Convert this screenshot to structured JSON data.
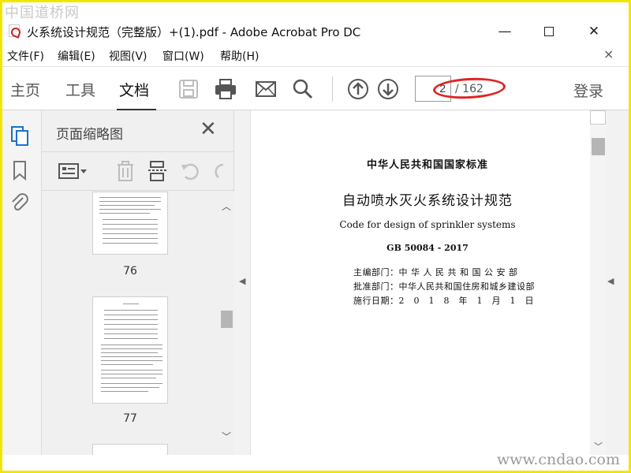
{
  "watermarks": {
    "top": "中国道桥网",
    "bottom": "www.cndao.com"
  },
  "window": {
    "title": "火系统设计规范（完整版）+(1).pdf - Adobe Acrobat Pro DC",
    "minimize": "—",
    "close": "✕"
  },
  "menu": {
    "items": [
      "文件(F)",
      "编辑(E)",
      "视图(V)",
      "窗口(W)",
      "帮助(H)"
    ],
    "close": "×"
  },
  "toolbar": {
    "tabs": [
      "主页",
      "工具",
      "文档"
    ],
    "active_tab": "文档",
    "tools": [
      "save-icon",
      "print-icon",
      "mail-icon",
      "search-icon",
      "page-up-icon",
      "page-down-icon"
    ],
    "page_current": "2",
    "page_total": "/ 162",
    "login": "登录",
    "highlight_color": "#e02424"
  },
  "thumbnail_pane": {
    "title": "页面缩略图",
    "close": "✕",
    "tools": [
      "thumbnail-options-icon",
      "delete-icon",
      "extract-icon",
      "undo-icon",
      "redo-icon"
    ],
    "thumbnails": [
      {
        "label": "76"
      },
      {
        "label": "77"
      }
    ]
  },
  "document": {
    "standard": "中华人民共和国国家标准",
    "title": "自动喷水灭火系统设计规范",
    "title_en": "Code for design of sprinkler systems",
    "code": "GB 50084 - 2017",
    "info": [
      "主编部门：中 华 人 民 共 和 国 公 安 部",
      "批准部门：中华人民共和国住房和城乡建设部",
      "施行日期：2　0　1　8　年　1　月　1　日"
    ]
  },
  "colors": {
    "frame": "#f2e600",
    "rail_active": "#1a73c9"
  }
}
